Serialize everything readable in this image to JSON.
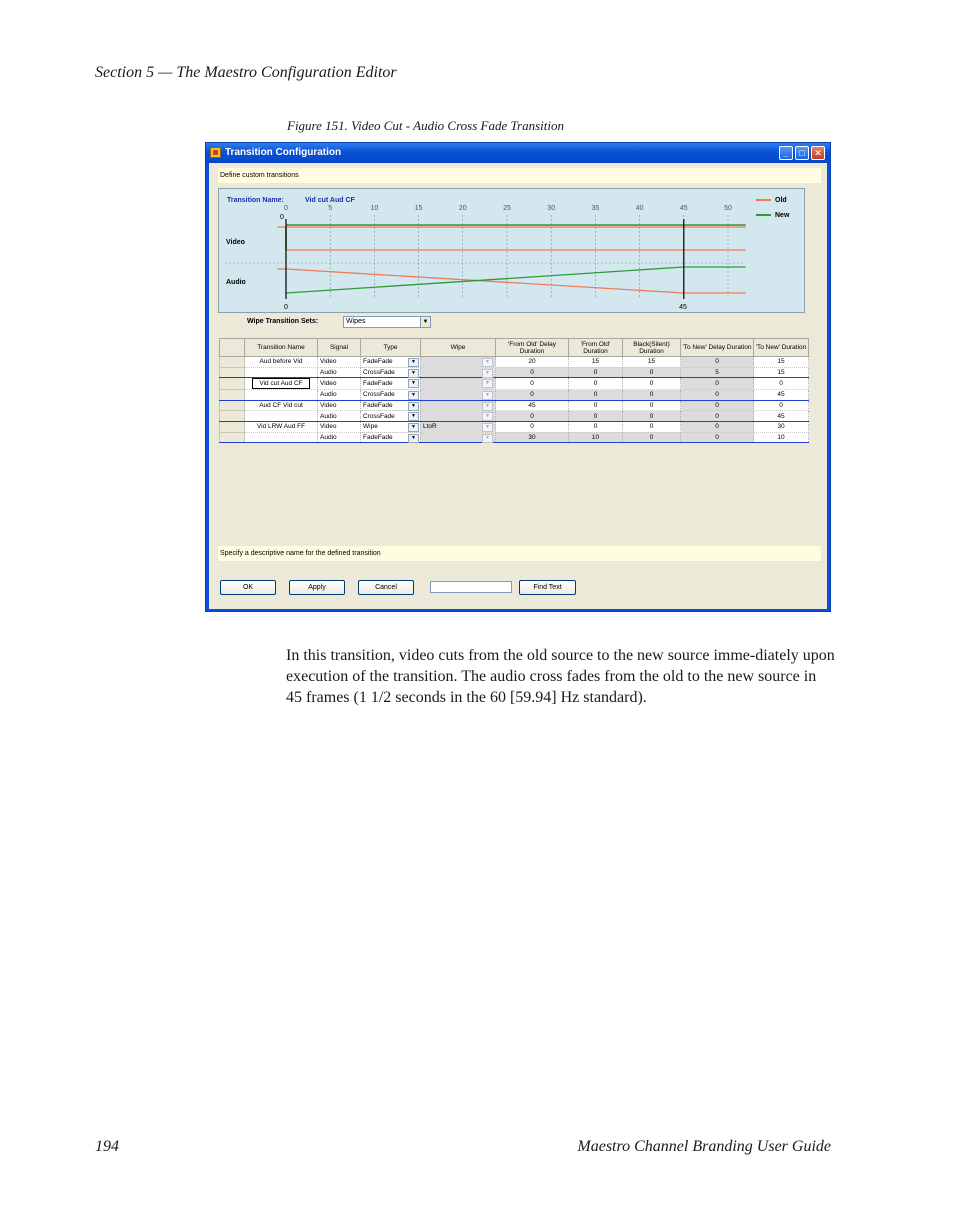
{
  "page": {
    "running_head": "Section 5  —  The Maestro Configuration Editor",
    "figure_caption": "Figure 151.  Video Cut - Audio Cross Fade Transition",
    "paragraph": "In this transition, video cuts from the old source to the new source imme-diately upon execution of the transition. The audio cross fades from the old to the new source in 45 frames (1 1/2 seconds in the 60 [59.94] Hz standard).",
    "folio": "194",
    "book_title": "Maestro Channel Branding User Guide"
  },
  "window": {
    "title": "Transition Configuration",
    "define_hint": "Define custom transitions",
    "chart": {
      "name_label": "Transition Name:",
      "name_value": "Vid cut Aud CF",
      "ticks": [
        "0",
        "5",
        "10",
        "15",
        "20",
        "25",
        "30",
        "35",
        "40",
        "45",
        "50"
      ],
      "video_label": "Video",
      "audio_label": "Audio",
      "marker_top": "0",
      "marker_bottom_start": "0",
      "marker_bottom_end": "45",
      "legend_old": "Old",
      "legend_new": "New",
      "color_old": "#f07a5a",
      "color_new": "#2e9a3a"
    },
    "wipe_sets": {
      "label": "Wipe Transition Sets:",
      "value": "Wipes"
    },
    "table": {
      "columns": [
        "Transition Name",
        "Signal",
        "Type",
        "Wipe",
        "'From Old' Delay Duration",
        "'From Old' Duration",
        "Black(Silent) Duration",
        "'To New' Delay Duration",
        "'To New' Duration"
      ],
      "rows": [
        {
          "name": "Aud before Vid",
          "signal": "Video",
          "type": "FadeFade",
          "wipe": "",
          "fod": "20",
          "fo": "15",
          "bs": "15",
          "tnd": "0",
          "tn": "15"
        },
        {
          "name": "",
          "signal": "Audio",
          "type": "CrossFade",
          "wipe": "",
          "fod": "0",
          "fo": "0",
          "bs": "0",
          "tnd": "5",
          "tn": "15"
        },
        {
          "name": "Vid cut Aud CF",
          "signal": "Video",
          "type": "FadeFade",
          "wipe": "",
          "fod": "0",
          "fo": "0",
          "bs": "0",
          "tnd": "0",
          "tn": "0"
        },
        {
          "name": "",
          "signal": "Audio",
          "type": "CrossFade",
          "wipe": "",
          "fod": "0",
          "fo": "0",
          "bs": "0",
          "tnd": "0",
          "tn": "45"
        },
        {
          "name": "Aud CF Vid cut",
          "signal": "Video",
          "type": "FadeFade",
          "wipe": "",
          "fod": "45",
          "fo": "0",
          "bs": "0",
          "tnd": "0",
          "tn": "0"
        },
        {
          "name": "",
          "signal": "Audio",
          "type": "CrossFade",
          "wipe": "",
          "fod": "0",
          "fo": "0",
          "bs": "0",
          "tnd": "0",
          "tn": "45"
        },
        {
          "name": "Vid LRW Aud FF",
          "signal": "Video",
          "type": "Wipe",
          "wipe": "LtoR",
          "fod": "0",
          "fo": "0",
          "bs": "0",
          "tnd": "0",
          "tn": "30"
        },
        {
          "name": "",
          "signal": "Audio",
          "type": "FadeFade",
          "wipe": "",
          "fod": "30",
          "fo": "10",
          "bs": "0",
          "tnd": "0",
          "tn": "10"
        }
      ]
    },
    "status_hint": "Specify a descriptive name for the defined transition",
    "buttons": {
      "ok": "OK",
      "apply": "Apply",
      "cancel": "Cancel",
      "find": "Find Text"
    },
    "find_value": ""
  }
}
